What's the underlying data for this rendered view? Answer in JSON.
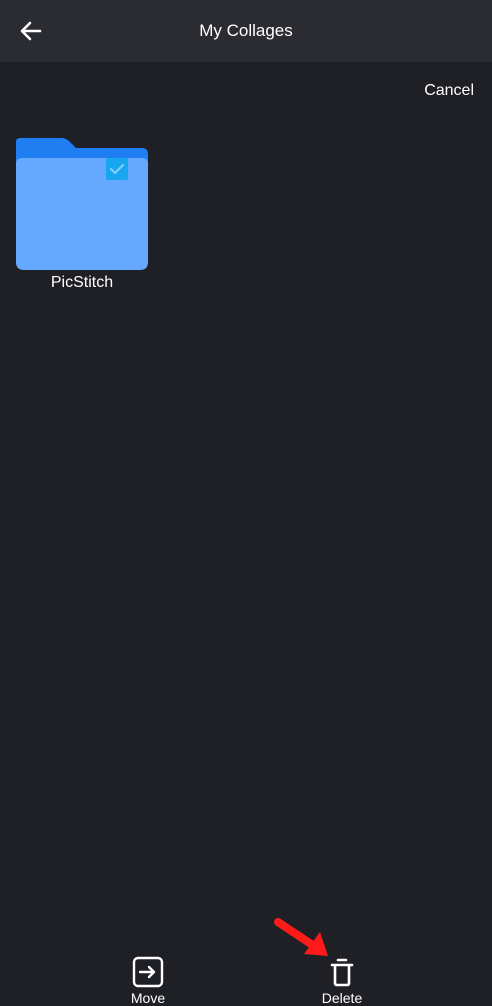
{
  "header": {
    "title": "My Collages",
    "back_icon": "arrow-left-icon"
  },
  "selection": {
    "cancel_label": "Cancel"
  },
  "folders": [
    {
      "name": "PicStitch",
      "icon": "folder-icon",
      "selected": true
    }
  ],
  "bottom_actions": {
    "move": {
      "label": "Move",
      "icon": "move-icon"
    },
    "delete": {
      "label": "Delete",
      "icon": "trash-icon"
    }
  },
  "annotation": {
    "icon": "red-arrow-pointer-icon",
    "color": "#ff1a1a"
  },
  "colors": {
    "background": "#1f2025",
    "header": "#2b2c32",
    "folder_front": "#64a8ff",
    "folder_back": "#1e7ef2",
    "checkbox": "#19a6f0"
  }
}
